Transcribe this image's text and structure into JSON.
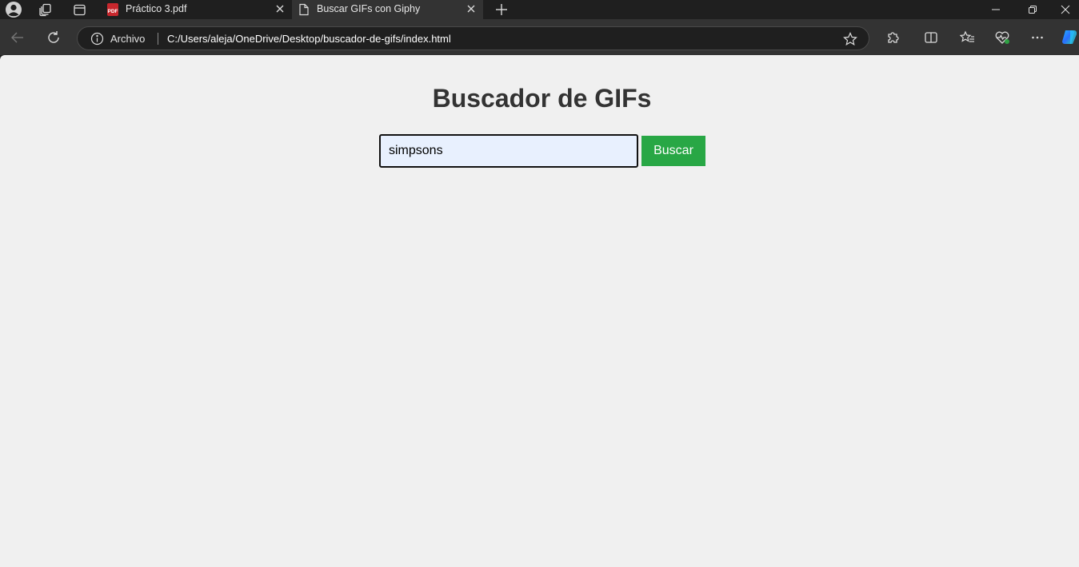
{
  "tabs": [
    {
      "label": "Práctico 3.pdf",
      "icon": "pdf-icon",
      "active": false
    },
    {
      "label": "Buscar GIFs con Giphy",
      "icon": "page-icon",
      "active": true
    }
  ],
  "tab_icon_text": "PDF",
  "address_bar": {
    "security_label": "Archivo",
    "url": "C:/Users/aleja/OneDrive/Desktop/buscador-de-gifs/index.html"
  },
  "page": {
    "title": "Buscador de GIFs",
    "search_value": "simpsons",
    "search_button_label": "Buscar"
  },
  "colors": {
    "page_background": "#f0f0f0",
    "button_background": "#28a745",
    "input_background": "#e8f0fe",
    "title_color": "#333333"
  }
}
